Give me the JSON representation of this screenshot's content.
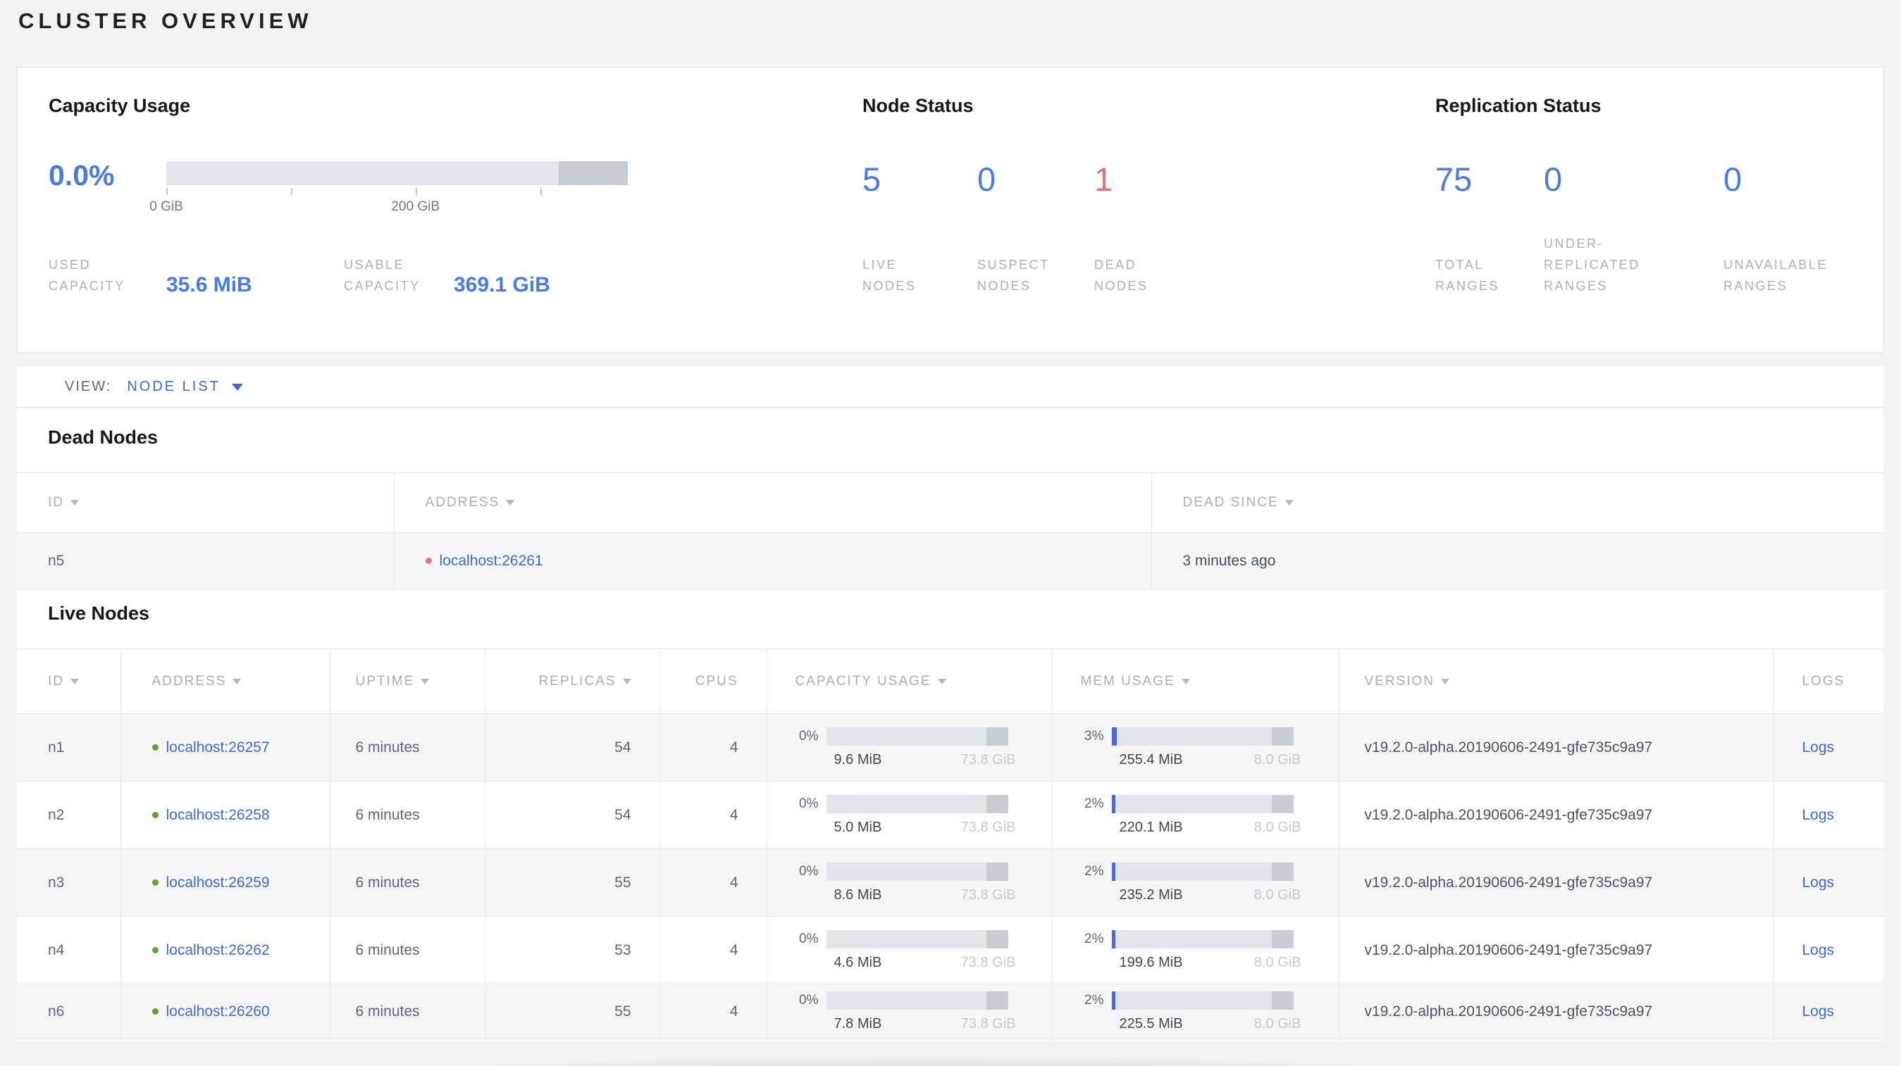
{
  "page": {
    "title": "CLUSTER OVERVIEW"
  },
  "colors": {
    "accent_blue": "#4a7ce0",
    "link_blue": "#3e6ad1",
    "dead_red": "#e0767f",
    "live_green": "#61a32e"
  },
  "summary": {
    "capacity": {
      "title": "Capacity Usage",
      "percent": "0.0%",
      "axis_ticks": [
        "0 GiB",
        "200 GiB"
      ],
      "stats": [
        {
          "label": "USED CAPACITY",
          "value": "35.6 MiB"
        },
        {
          "label": "USABLE CAPACITY",
          "value": "369.1 GiB"
        }
      ]
    },
    "node_status": {
      "title": "Node Status",
      "stats": [
        {
          "value": "5",
          "label": "LIVE NODES"
        },
        {
          "value": "0",
          "label": "SUSPECT NODES"
        },
        {
          "value": "1",
          "label": "DEAD NODES"
        }
      ]
    },
    "replication": {
      "title": "Replication Status",
      "stats": [
        {
          "value": "75",
          "label": "TOTAL RANGES"
        },
        {
          "value": "0",
          "label": "UNDER-REPLICATED RANGES"
        },
        {
          "value": "0",
          "label": "UNAVAILABLE RANGES"
        }
      ]
    }
  },
  "view_bar": {
    "label": "VIEW:",
    "selected": "NODE LIST"
  },
  "dead_nodes": {
    "title": "Dead Nodes",
    "columns": [
      "ID",
      "ADDRESS",
      "DEAD SINCE"
    ],
    "rows": [
      {
        "id": "n5",
        "address": "localhost:26261",
        "dead_since": "3 minutes ago"
      }
    ]
  },
  "live_nodes": {
    "title": "Live Nodes",
    "columns": [
      "ID",
      "ADDRESS",
      "UPTIME",
      "REPLICAS",
      "CPUS",
      "CAPACITY USAGE",
      "MEM USAGE",
      "VERSION",
      "LOGS"
    ],
    "rows": [
      {
        "id": "n1",
        "address": "localhost:26257",
        "uptime": "6 minutes",
        "replicas": "54",
        "cpus": "4",
        "capacity": {
          "percent": "0%",
          "used": "9.6 MiB",
          "total": "73.8 GiB"
        },
        "memory": {
          "percent": "3%",
          "used": "255.4 MiB",
          "total": "8.0 GiB"
        },
        "version": "v19.2.0-alpha.20190606-2491-gfe735c9a97",
        "logs_label": "Logs"
      },
      {
        "id": "n2",
        "address": "localhost:26258",
        "uptime": "6 minutes",
        "replicas": "54",
        "cpus": "4",
        "capacity": {
          "percent": "0%",
          "used": "5.0 MiB",
          "total": "73.8 GiB"
        },
        "memory": {
          "percent": "2%",
          "used": "220.1 MiB",
          "total": "8.0 GiB"
        },
        "version": "v19.2.0-alpha.20190606-2491-gfe735c9a97",
        "logs_label": "Logs"
      },
      {
        "id": "n3",
        "address": "localhost:26259",
        "uptime": "6 minutes",
        "replicas": "55",
        "cpus": "4",
        "capacity": {
          "percent": "0%",
          "used": "8.6 MiB",
          "total": "73.8 GiB"
        },
        "memory": {
          "percent": "2%",
          "used": "235.2 MiB",
          "total": "8.0 GiB"
        },
        "version": "v19.2.0-alpha.20190606-2491-gfe735c9a97",
        "logs_label": "Logs"
      },
      {
        "id": "n4",
        "address": "localhost:26262",
        "uptime": "6 minutes",
        "replicas": "53",
        "cpus": "4",
        "capacity": {
          "percent": "0%",
          "used": "4.6 MiB",
          "total": "73.8 GiB"
        },
        "memory": {
          "percent": "2%",
          "used": "199.6 MiB",
          "total": "8.0 GiB"
        },
        "version": "v19.2.0-alpha.20190606-2491-gfe735c9a97",
        "logs_label": "Logs"
      },
      {
        "id": "n6",
        "address": "localhost:26260",
        "uptime": "6 minutes",
        "replicas": "55",
        "cpus": "4",
        "capacity": {
          "percent": "0%",
          "used": "7.8 MiB",
          "total": "73.8 GiB"
        },
        "memory": {
          "percent": "2%",
          "used": "225.5 MiB",
          "total": "8.0 GiB"
        },
        "version": "v19.2.0-alpha.20190606-2491-gfe735c9a97",
        "logs_label": "Logs"
      }
    ]
  }
}
